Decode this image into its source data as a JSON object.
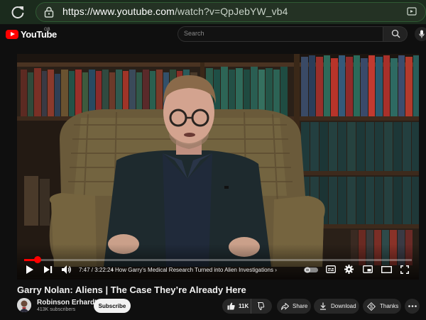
{
  "browser": {
    "url_host": "https://www.youtube.com",
    "url_path": "/watch?v=QpJebYW_vb4",
    "icons": {
      "reload": "reload-icon",
      "lock": "lock-icon",
      "cast": "cast-icon"
    }
  },
  "header": {
    "logo_text": "YouTube",
    "country_code": "GB",
    "search_placeholder": "Search",
    "icons": {
      "search": "search-icon",
      "mic": "mic-icon"
    }
  },
  "player": {
    "progress_fraction": 0.035,
    "current_time": "7:47",
    "duration": "3:22:24",
    "separator": " / ",
    "chapter": "How Garry's Medical Research Turned into Alien Investigations",
    "colors": {
      "progress": "#ff0000"
    }
  },
  "video": {
    "title": "Garry Nolan: Aliens | The Case They’re Already Here"
  },
  "channel": {
    "name": "Robinson Erhardt",
    "subscribers": "413K subscribers",
    "subscribe_label": "Subscribe"
  },
  "actions": {
    "likes": "11K",
    "share_label": "Share",
    "download_label": "Download",
    "thanks_label": "Thanks"
  }
}
